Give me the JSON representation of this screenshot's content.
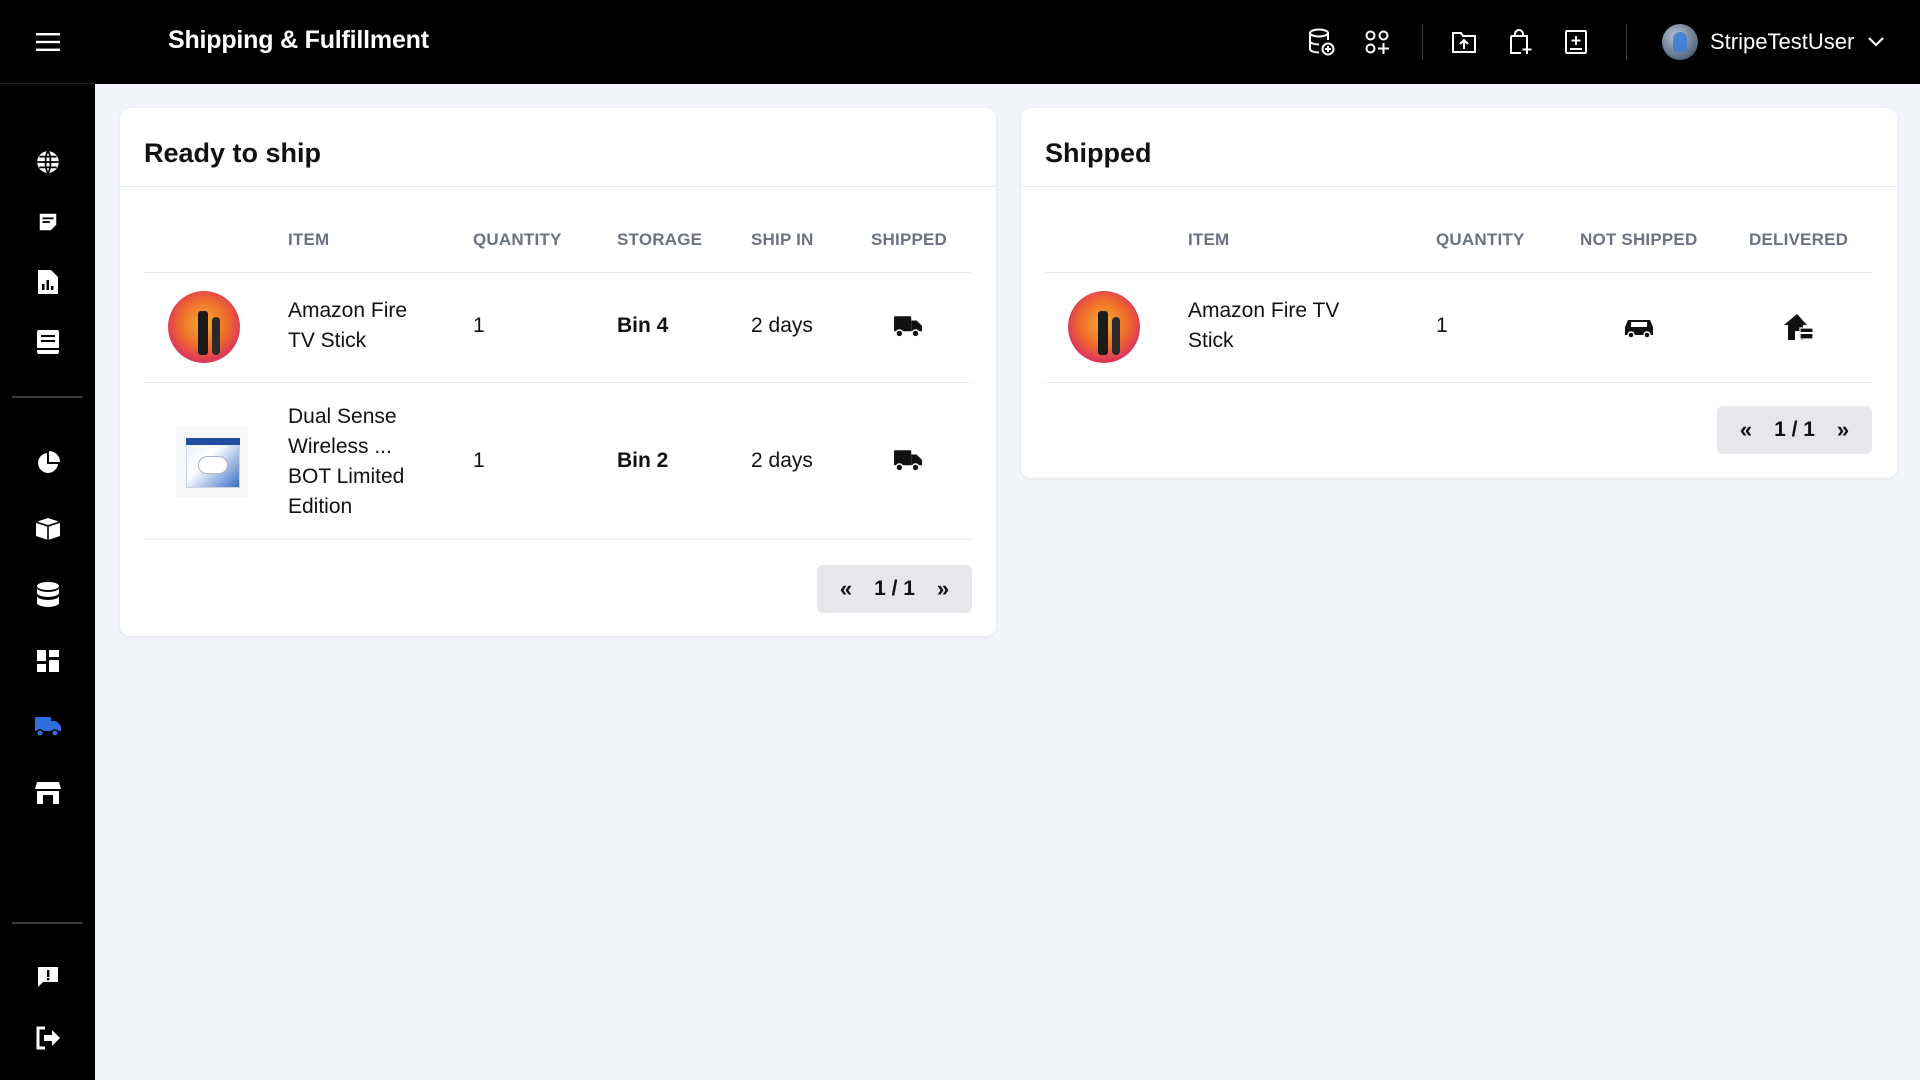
{
  "header": {
    "title": "Shipping & Fulfillment",
    "icons": [
      "database-add-icon",
      "apps-add-icon",
      "upload-folder-icon",
      "bag-add-icon",
      "add-box-icon"
    ],
    "user": {
      "name": "StripeTestUser"
    }
  },
  "sidebar": {
    "items": [
      {
        "name": "globe-icon",
        "active": false
      },
      {
        "name": "notes-icon",
        "active": false
      },
      {
        "name": "report-icon",
        "active": false
      },
      {
        "name": "book-icon",
        "active": false
      },
      {
        "name": "pie-chart-icon",
        "active": false
      },
      {
        "name": "box-icon",
        "active": false
      },
      {
        "name": "database-icon",
        "active": false
      },
      {
        "name": "dashboard-icon",
        "active": false
      },
      {
        "name": "truck-icon",
        "active": true
      },
      {
        "name": "store-icon",
        "active": false
      }
    ],
    "bottom": [
      {
        "name": "feedback-icon"
      },
      {
        "name": "logout-icon"
      }
    ],
    "active_color": "#2f6fe0"
  },
  "ready": {
    "title": "Ready to ship",
    "columns": [
      "ITEM",
      "QUANTITY",
      "STORAGE",
      "SHIP IN",
      "SHIPPED"
    ],
    "rows": [
      {
        "name": "Amazon Fire TV Stick",
        "line1": "Amazon Fire",
        "line2": "TV Stick",
        "quantity": "1",
        "storage": "Bin 4",
        "ship_in": "2 days",
        "thumb": "fire"
      },
      {
        "name": "Dual Sense Wireless ... BOT Limited Edition",
        "line1": "Dual Sense",
        "line2": "Wireless ...",
        "line3": "BOT Limited",
        "line4": "Edition",
        "quantity": "1",
        "storage": "Bin 2",
        "ship_in": "2 days",
        "thumb": "ps"
      }
    ],
    "pager": {
      "prev": "«",
      "page": "1 / 1",
      "next": "»"
    }
  },
  "shipped": {
    "title": "Shipped",
    "columns": [
      "ITEM",
      "QUANTITY",
      "NOT SHIPPED",
      "DELIVERED"
    ],
    "rows": [
      {
        "name": "Amazon Fire TV Stick",
        "line1": "Amazon Fire TV",
        "line2": "Stick",
        "quantity": "1",
        "thumb": "fire"
      }
    ],
    "pager": {
      "prev": "«",
      "page": "1 / 1",
      "next": "»"
    }
  }
}
